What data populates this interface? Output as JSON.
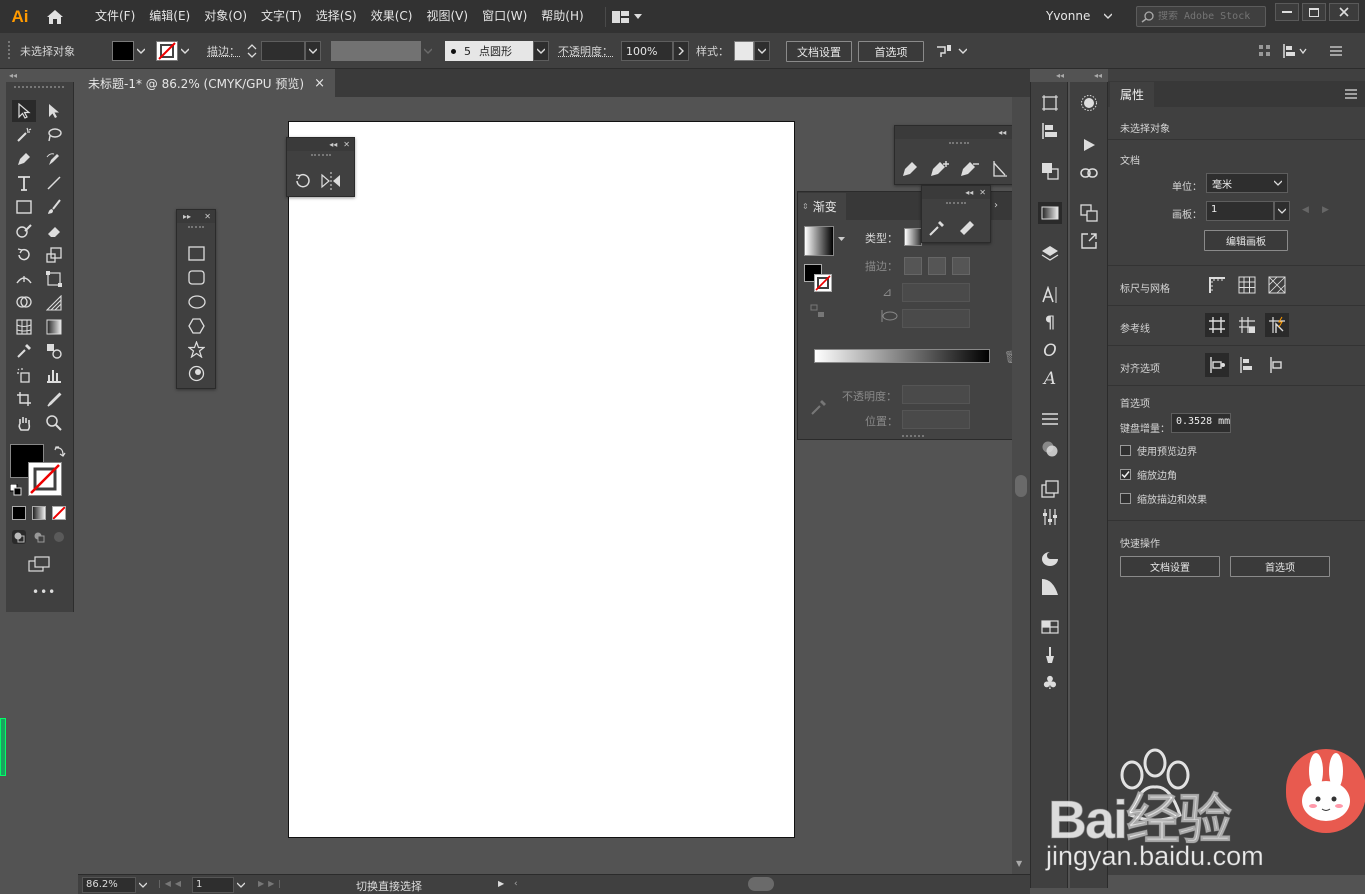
{
  "app": {
    "logo": "Ai",
    "user": "Yvonne",
    "stock_placeholder": "搜索 Adobe Stock"
  },
  "menu": [
    "文件(F)",
    "编辑(E)",
    "对象(O)",
    "文字(T)",
    "选择(S)",
    "效果(C)",
    "视图(V)",
    "窗口(W)",
    "帮助(H)"
  ],
  "control": {
    "selection": "未选择对象",
    "stroke_label": "描边：",
    "brush_size": "5",
    "brush_name": "点圆形",
    "opacity_label": "不透明度：",
    "opacity_value": "100%",
    "style_label": "样式：",
    "doc_setup": "文档设置",
    "preferences": "首选项"
  },
  "document": {
    "tab_title": "未标题-1* @ 86.2% (CMYK/GPU 预览)",
    "close": "×"
  },
  "gradient_panel": {
    "title": "渐变",
    "type_label": "类型：",
    "stroke_label": "描边：",
    "opacity_label": "不透明度：",
    "location_label": "位置："
  },
  "properties": {
    "tab": "属性",
    "no_selection": "未选择对象",
    "doc_section": "文档",
    "units_label": "单位：",
    "units_value": "毫米",
    "artboard_label": "画板：",
    "artboard_value": "1",
    "edit_artboards": "编辑画板",
    "rulers_grids": "标尺与网格",
    "guides": "参考线",
    "align_options": "对齐选项",
    "prefs_section": "首选项",
    "keyboard_inc_label": "键盘增量：",
    "keyboard_inc_value": "0.3528 mm",
    "use_preview_bounds": "使用预览边界",
    "scale_corners": "缩放边角",
    "scale_strokes": "缩放描边和效果",
    "quick_actions": "快速操作",
    "doc_setup": "文档设置",
    "preferences": "首选项"
  },
  "status": {
    "zoom": "86.2%",
    "artboard": "1",
    "tool_hint": "切换直接选择"
  },
  "watermark": {
    "brand": "Bai经验",
    "url": "jingyan.baidu.com"
  },
  "colors": {
    "accent_logo": "#ff9a00",
    "ui_dark": "#323232",
    "ui_mid": "#404040",
    "canvas": "#535353"
  }
}
